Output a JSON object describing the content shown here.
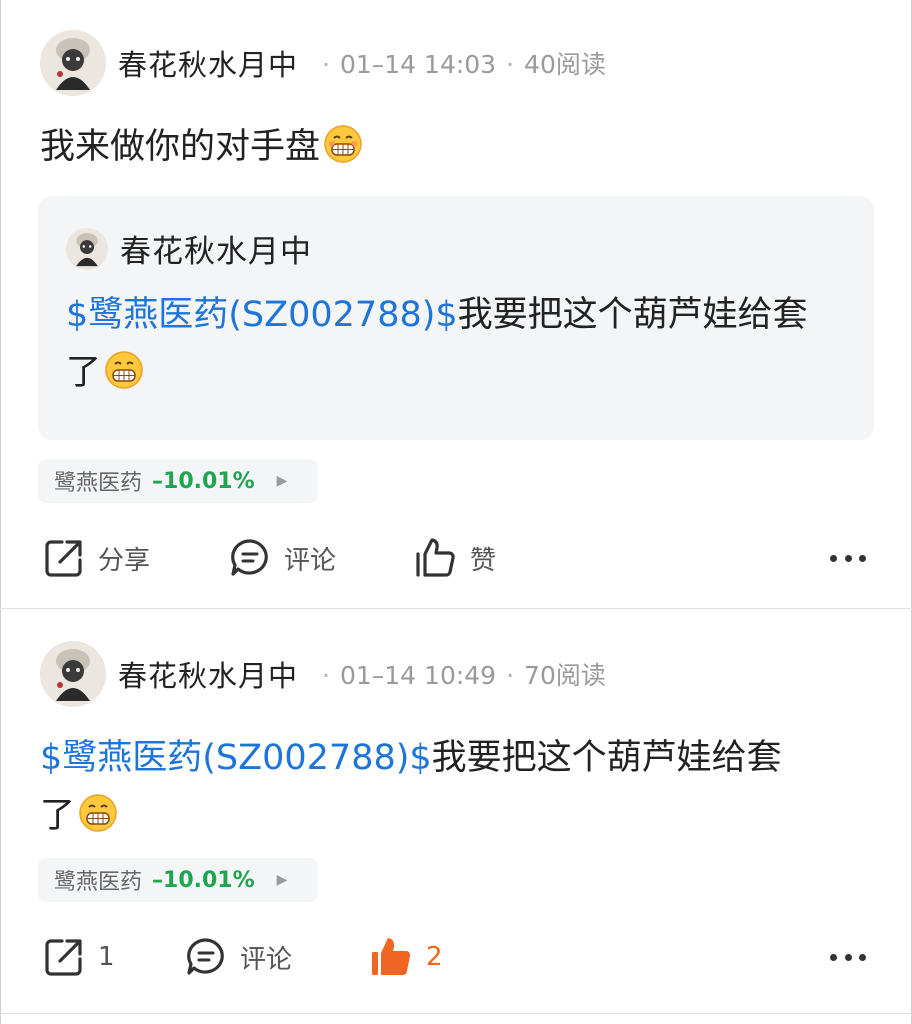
{
  "posts": [
    {
      "author": "春花秋水月中",
      "date": "01–14 14:03",
      "reads": "40阅读",
      "text": "我来做你的对手盘",
      "emoji": "grinning-face-with-teeth",
      "quote": {
        "author": "春花秋水月中",
        "link": "$鹭燕医药(SZ002788)$",
        "text_line1": "我要把这个葫芦娃给套",
        "text_line2": "了"
      },
      "stock": {
        "name": "鹭燕医药",
        "change": "–10.01%",
        "color": "#1fa550"
      },
      "actions": {
        "share": "分享",
        "comment": "评论",
        "like": "赞"
      }
    },
    {
      "author": "春花秋水月中",
      "date": "01–14 10:49",
      "reads": "70阅读",
      "link": "$鹭燕医药(SZ002788)$",
      "text_line1": "我要把这个葫芦娃给套",
      "text_line2": "了",
      "stock": {
        "name": "鹭燕医药",
        "change": "–10.01%",
        "color": "#1fa550"
      },
      "actions": {
        "share": "1",
        "comment": "评论",
        "like": "2"
      }
    }
  ],
  "colors": {
    "link": "#1d74d9",
    "liked": "#f06522",
    "down": "#1fa550"
  }
}
